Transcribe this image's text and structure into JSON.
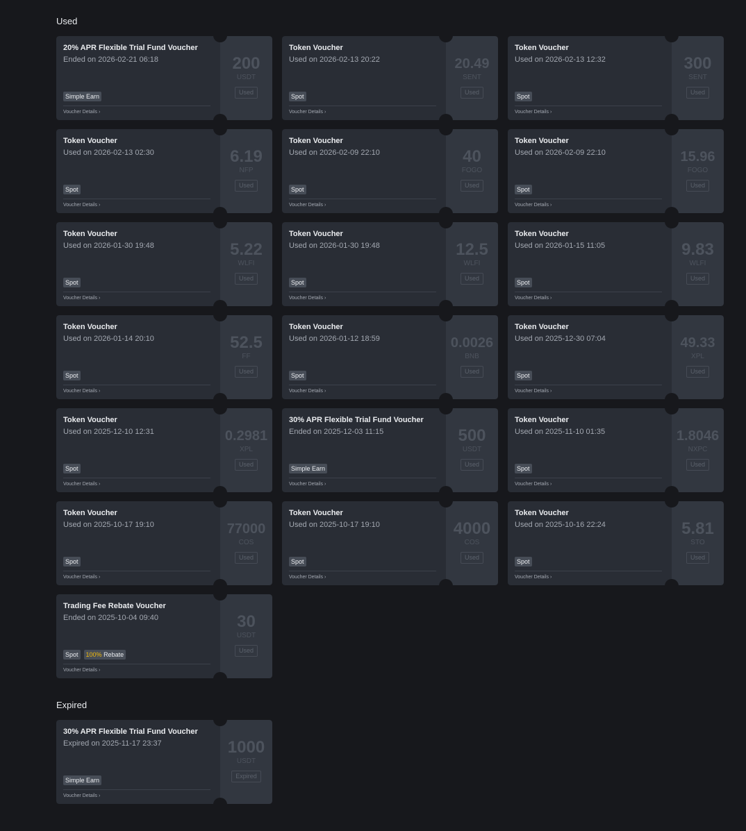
{
  "sections": {
    "used": {
      "title": "Used",
      "vouchers": [
        {
          "title": "20% APR Flexible Trial Fund Voucher",
          "date": "Ended on 2026-02-21 06:18",
          "tags": [
            "Simple Earn"
          ],
          "details": "Voucher Details",
          "amount": "200",
          "unit": "USDT",
          "status": "Used"
        },
        {
          "title": "Token Voucher",
          "date": "Used on 2026-02-13 20:22",
          "tags": [
            "Spot"
          ],
          "details": "Voucher Details",
          "amount": "20.49",
          "unit": "SENT",
          "status": "Used"
        },
        {
          "title": "Token Voucher",
          "date": "Used on 2026-02-13 12:32",
          "tags": [
            "Spot"
          ],
          "details": "Voucher Details",
          "amount": "300",
          "unit": "SENT",
          "status": "Used"
        },
        {
          "title": "Token Voucher",
          "date": "Used on 2026-02-13 02:30",
          "tags": [
            "Spot"
          ],
          "details": "Voucher Details",
          "amount": "6.19",
          "unit": "NFP",
          "status": "Used"
        },
        {
          "title": "Token Voucher",
          "date": "Used on 2026-02-09 22:10",
          "tags": [
            "Spot"
          ],
          "details": "Voucher Details",
          "amount": "40",
          "unit": "FOGO",
          "status": "Used"
        },
        {
          "title": "Token Voucher",
          "date": "Used on 2026-02-09 22:10",
          "tags": [
            "Spot"
          ],
          "details": "Voucher Details",
          "amount": "15.96",
          "unit": "FOGO",
          "status": "Used"
        },
        {
          "title": "Token Voucher",
          "date": "Used on 2026-01-30 19:48",
          "tags": [
            "Spot"
          ],
          "details": "Voucher Details",
          "amount": "5.22",
          "unit": "WLFI",
          "status": "Used"
        },
        {
          "title": "Token Voucher",
          "date": "Used on 2026-01-30 19:48",
          "tags": [
            "Spot"
          ],
          "details": "Voucher Details",
          "amount": "12.5",
          "unit": "WLFI",
          "status": "Used"
        },
        {
          "title": "Token Voucher",
          "date": "Used on 2026-01-15 11:05",
          "tags": [
            "Spot"
          ],
          "details": "Voucher Details",
          "amount": "9.83",
          "unit": "WLFI",
          "status": "Used"
        },
        {
          "title": "Token Voucher",
          "date": "Used on 2026-01-14 20:10",
          "tags": [
            "Spot"
          ],
          "details": "Voucher Details",
          "amount": "52.5",
          "unit": "FF",
          "status": "Used"
        },
        {
          "title": "Token Voucher",
          "date": "Used on 2026-01-12 18:59",
          "tags": [
            "Spot"
          ],
          "details": "Voucher Details",
          "amount": "0.0026",
          "unit": "BNB",
          "status": "Used"
        },
        {
          "title": "Token Voucher",
          "date": "Used on 2025-12-30 07:04",
          "tags": [
            "Spot"
          ],
          "details": "Voucher Details",
          "amount": "49.33",
          "unit": "XPL",
          "status": "Used"
        },
        {
          "title": "Token Voucher",
          "date": "Used on 2025-12-10 12:31",
          "tags": [
            "Spot"
          ],
          "details": "Voucher Details",
          "amount": "0.2981",
          "unit": "XPL",
          "status": "Used"
        },
        {
          "title": "30% APR Flexible Trial Fund Voucher",
          "date": "Ended on 2025-12-03 11:15",
          "tags": [
            "Simple Earn"
          ],
          "details": "Voucher Details",
          "amount": "500",
          "unit": "USDT",
          "status": "Used"
        },
        {
          "title": "Token Voucher",
          "date": "Used on 2025-11-10 01:35",
          "tags": [
            "Spot"
          ],
          "details": "Voucher Details",
          "amount": "1.8046",
          "unit": "NXPC",
          "status": "Used"
        },
        {
          "title": "Token Voucher",
          "date": "Used on 2025-10-17 19:10",
          "tags": [
            "Spot"
          ],
          "details": "Voucher Details",
          "amount": "77000",
          "unit": "COS",
          "status": "Used"
        },
        {
          "title": "Token Voucher",
          "date": "Used on 2025-10-17 19:10",
          "tags": [
            "Spot"
          ],
          "details": "Voucher Details",
          "amount": "4000",
          "unit": "COS",
          "status": "Used"
        },
        {
          "title": "Token Voucher",
          "date": "Used on 2025-10-16 22:24",
          "tags": [
            "Spot"
          ],
          "details": "Voucher Details",
          "amount": "5.81",
          "unit": "STO",
          "status": "Used"
        },
        {
          "title": "Trading Fee Rebate Voucher",
          "date": "Ended on 2025-10-04 09:40",
          "tags": [
            "Spot"
          ],
          "rebate": {
            "percent": "100%",
            "label": "Rebate"
          },
          "details": "Voucher Details",
          "amount": "30",
          "unit": "USDT",
          "status": "Used"
        }
      ]
    },
    "expired": {
      "title": "Expired",
      "vouchers": [
        {
          "title": "30% APR Flexible Trial Fund Voucher",
          "date": "Expired on 2025-11-17 23:37",
          "tags": [
            "Simple Earn"
          ],
          "details": "Voucher Details",
          "amount": "1000",
          "unit": "USDT",
          "status": "Expired"
        }
      ]
    }
  },
  "icons": {
    "details_chevron": "chevron-right-icon"
  },
  "colors": {
    "background": "#17181c",
    "card_left": "#292d35",
    "card_right": "#323740",
    "accent": "#f0b90b"
  }
}
